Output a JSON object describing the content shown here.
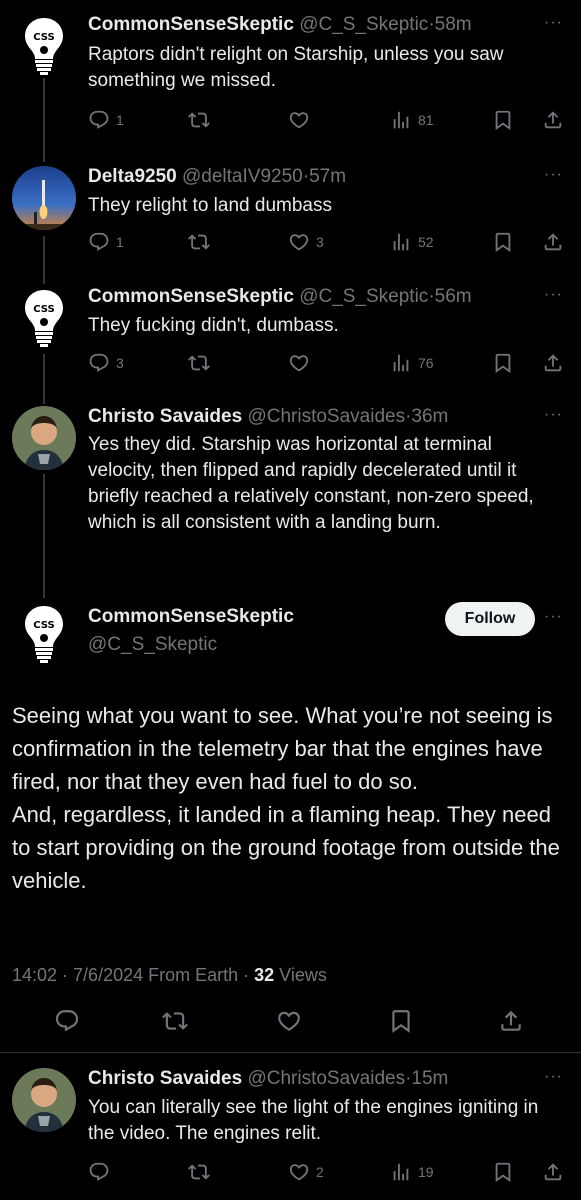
{
  "tweets": [
    {
      "name": "CommonSenseSkeptic",
      "handle": "@C_S_Skeptic",
      "time": "58m",
      "text": "Raptors didn't relight on Starship, unless you saw something we missed.",
      "replies": "1",
      "retweets": "",
      "likes": "",
      "views": "81",
      "avatar_icon": "lightbulb-css-logo"
    },
    {
      "name": "Delta9250",
      "handle": "@deltaIV9250",
      "time": "57m",
      "text": "They relight to land dumbass",
      "replies": "1",
      "retweets": "",
      "likes": "3",
      "views": "52",
      "avatar_icon": "rocket-launch-photo"
    },
    {
      "name": "CommonSenseSkeptic",
      "handle": "@C_S_Skeptic",
      "time": "56m",
      "text": "They fucking didn't, dumbass.",
      "replies": "3",
      "retweets": "",
      "likes": "",
      "views": "76",
      "avatar_icon": "lightbulb-css-logo"
    },
    {
      "name": "Christo Savaides",
      "handle": "@ChristoSavaides",
      "time": "36m",
      "text": "Yes they did. Starship was horizontal at terminal velocity, then flipped and rapidly decelerated until it briefly reached a relatively constant, non-zero speed, which is all consistent with a landing burn.",
      "avatar_icon": "person-photo"
    }
  ],
  "main": {
    "name": "CommonSenseSkeptic",
    "handle": "@C_S_Skeptic",
    "follow_label": "Follow",
    "text_p1": "Seeing what you want to see. What you’re not seeing is confirmation in the telemetry bar that the engines have fired, nor that they even had fuel to do so.",
    "text_p2": "And, regardless, it landed in a flaming heap. They need to start providing on the ground footage from outside the vehicle.",
    "timestamp": "14:02 · 7/6/2024 From Earth · ",
    "views_count": "32",
    "views_label": " Views"
  },
  "reply": {
    "name": "Christo Savaides",
    "handle": "@ChristoSavaides",
    "time": "15m",
    "text": "You can literally see the light of the engines igniting in the video. The engines relit.",
    "replies": "",
    "retweets": "",
    "likes": "2",
    "views": "19"
  },
  "separator": "·",
  "more_glyph": "···",
  "colors": {
    "background": "#000000",
    "text": "#e7e9ea",
    "muted": "#71767b",
    "follow_bg": "#eff3f4"
  }
}
